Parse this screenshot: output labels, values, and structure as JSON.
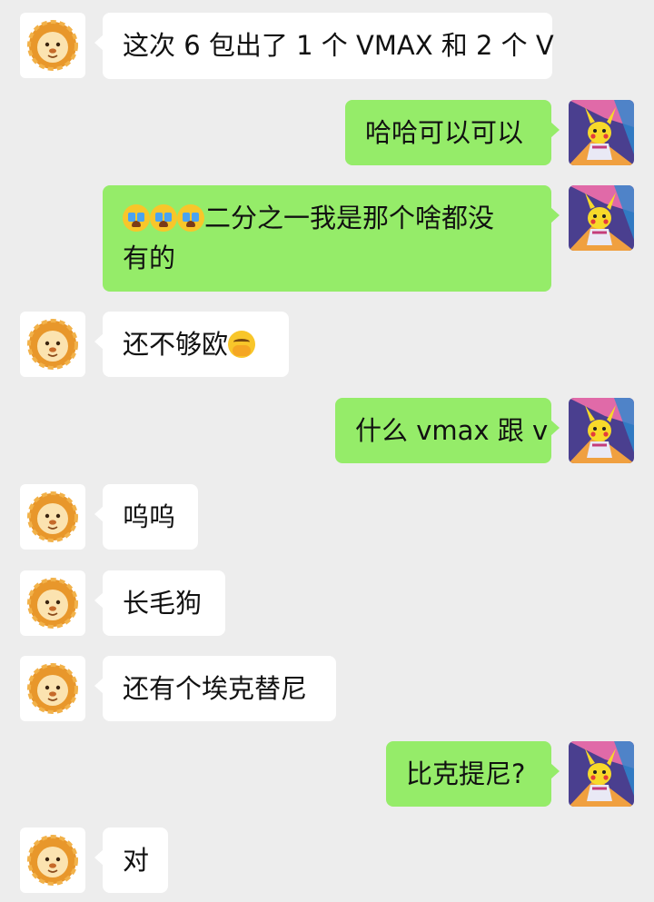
{
  "colors": {
    "background": "#ededed",
    "incoming_bubble": "#ffffff",
    "outgoing_bubble": "#95ec69"
  },
  "avatars": {
    "contact": "lion-avatar",
    "me": "pikachu-card-avatar"
  },
  "messages": [
    {
      "from": "contact",
      "text": "这次 6 包出了 1 个 VMAX 和 2 个 V"
    },
    {
      "from": "me",
      "text": "哈哈可以可以"
    },
    {
      "from": "me",
      "emoji": [
        "crying-face-emoji",
        "crying-face-emoji",
        "crying-face-emoji"
      ],
      "text_line1": "二分之一我是那个啥都没",
      "text_line2": "有的"
    },
    {
      "from": "contact",
      "text": "还不够欧",
      "emoji": "hand-over-mouth-emoji"
    },
    {
      "from": "me",
      "text": "什么 vmax 跟 v"
    },
    {
      "from": "contact",
      "text": "呜呜"
    },
    {
      "from": "contact",
      "text": "长毛狗"
    },
    {
      "from": "contact",
      "text": "还有个埃克替尼"
    },
    {
      "from": "me",
      "text": "比克提尼?"
    },
    {
      "from": "contact",
      "text": "对"
    }
  ]
}
